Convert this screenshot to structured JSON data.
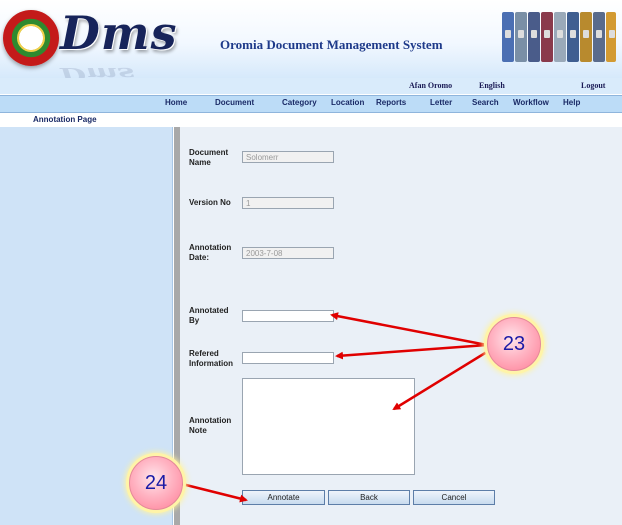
{
  "header": {
    "logo_text": "Dms",
    "title": "Oromia Document Management System"
  },
  "lang_bar": {
    "afan_oromo": "Afan Oromo",
    "english": "English",
    "logout": "Logout"
  },
  "menu": [
    "Home",
    "Document",
    "Category",
    "Location",
    "Reports",
    "Letter",
    "Search",
    "Workflow",
    "Help"
  ],
  "breadcrumb": "Annotation Page",
  "form": {
    "document_name_label": "Document Name",
    "document_name_value": "Solomerr",
    "version_label": "Version No",
    "version_value": "1",
    "annotation_date_label": "Annotation Date:",
    "annotation_date_value": "2003-7-08",
    "annotated_by_label": "Annotated By",
    "annotated_by_value": "",
    "refered_info_label": "Refered Information",
    "refered_info_value": "",
    "annotation_note_label": "Annotation Note",
    "annotation_note_value": ""
  },
  "buttons": {
    "annotate": "Annotate",
    "back": "Back",
    "cancel": "Cancel"
  },
  "callouts": {
    "fields_number": "23",
    "button_number": "24",
    "color": "#e00000"
  },
  "icons": [
    "seal-icon",
    "binders-icon"
  ]
}
